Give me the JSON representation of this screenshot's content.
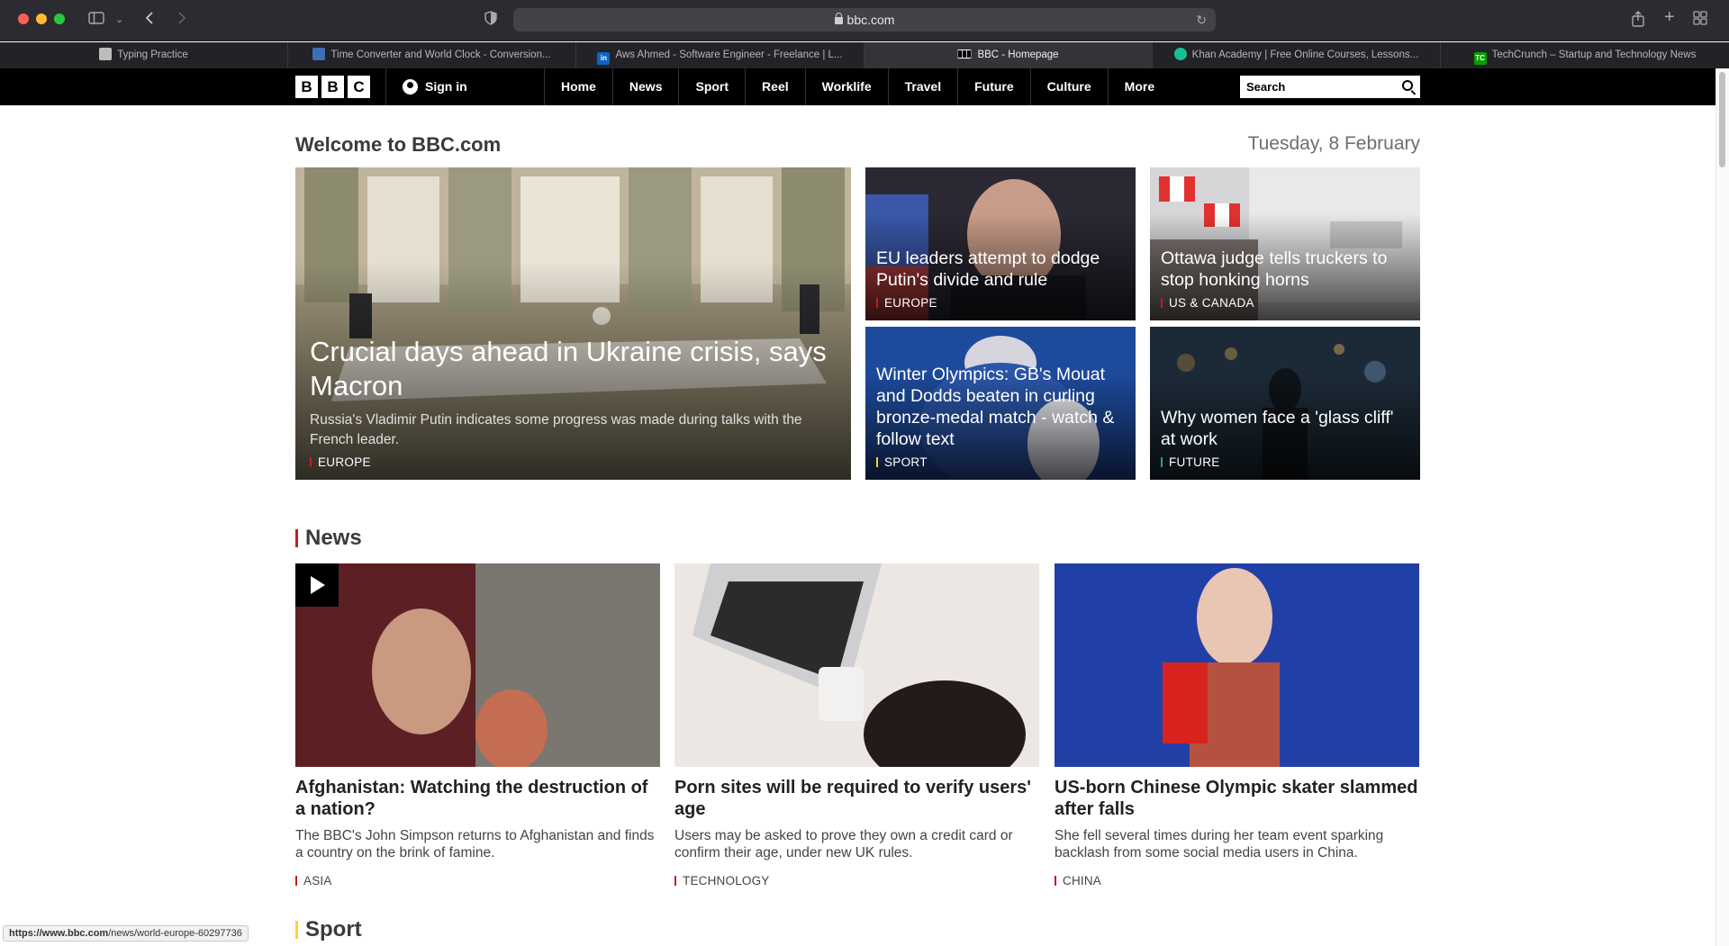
{
  "browser": {
    "address": "bbc.com",
    "status_url_bold": "https://www.bbc.com",
    "status_url_rest": "/news/world-europe-60297736",
    "tabs": [
      {
        "title": "Typing Practice",
        "icon": "typing-favicon"
      },
      {
        "title": "Time Converter and World Clock - Conversion...",
        "icon": "clock-favicon"
      },
      {
        "title": "Aws Ahmed - Software Engineer - Freelance | L...",
        "icon": "linkedin-favicon",
        "icon_text": "in"
      },
      {
        "title": "BBC - Homepage",
        "icon": "bbc-favicon",
        "active": true
      },
      {
        "title": "Khan Academy | Free Online Courses, Lessons...",
        "icon": "khan-favicon"
      },
      {
        "title": "TechCrunch – Startup and Technology News",
        "icon": "techcrunch-favicon",
        "icon_text": "TC"
      }
    ]
  },
  "nav": {
    "logo": [
      "B",
      "B",
      "C"
    ],
    "signin": "Sign in",
    "links": [
      "Home",
      "News",
      "Sport",
      "Reel",
      "Worklife",
      "Travel",
      "Future",
      "Culture"
    ],
    "more": "More",
    "search_placeholder": "Search"
  },
  "page": {
    "welcome": "Welcome to BBC.com",
    "date": "Tuesday, 8 February"
  },
  "hero": {
    "headline": "Crucial days ahead in Ukraine crisis, says Macron",
    "summary": "Russia's Vladimir Putin indicates some progress was made during talks with the French leader.",
    "tag": "EUROPE"
  },
  "grid": [
    {
      "headline": "EU leaders attempt to dodge Putin's divide and rule",
      "tag": "EUROPE"
    },
    {
      "headline": "Ottawa judge tells truckers to stop honking horns",
      "tag": "US & CANADA"
    },
    {
      "headline": "Winter Olympics: GB's Mouat and Dodds beaten in curling bronze-medal match - watch & follow text",
      "tag": "SPORT"
    },
    {
      "headline": "Why women face a 'glass cliff' at work",
      "tag": "FUTURE"
    }
  ],
  "news": {
    "title": "News",
    "items": [
      {
        "headline": "Afghanistan: Watching the destruction of a nation?",
        "summary": "The BBC's John Simpson returns to Afghanistan and finds a country on the brink of famine.",
        "tag": "ASIA"
      },
      {
        "headline": "Porn sites will be required to verify users' age",
        "summary": "Users may be asked to prove they own a credit card or confirm their age, under new UK rules.",
        "tag": "TECHNOLOGY"
      },
      {
        "headline": "US-born Chinese Olympic skater slammed after falls",
        "summary": "She fell several times during her team event sparking backlash from some social media users in China.",
        "tag": "CHINA"
      }
    ]
  },
  "sport": {
    "title": "Sport"
  },
  "colors": {
    "news_accent": "#c51c1c",
    "sport_accent": "#ffd230",
    "future_accent": "#2b9d9d",
    "nav_bg": "#000000"
  }
}
